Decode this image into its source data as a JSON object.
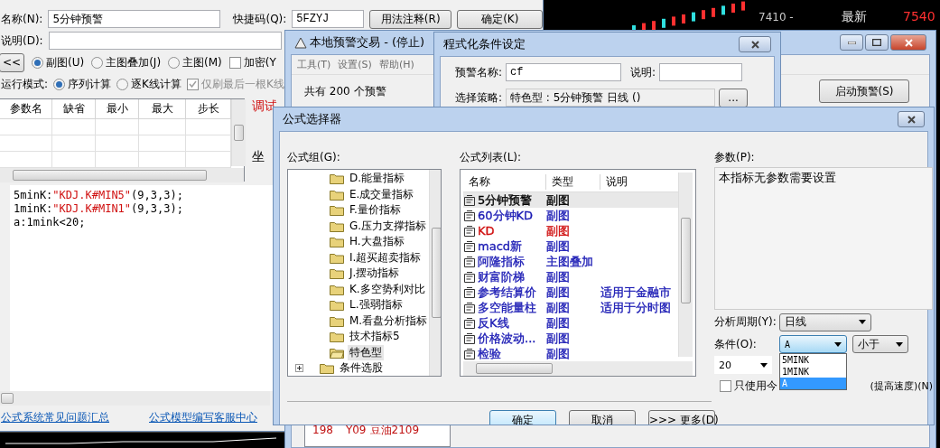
{
  "editor": {
    "name_label": "名称(N):",
    "name_value": "5分钟预警",
    "shortcut_label": "快捷码(Q):",
    "shortcut_value": "5FZYJ",
    "usage_button": "用法注释(R)",
    "ok_button": "确定(K)",
    "desc_label": "说明(D):",
    "collapse_button": "<<",
    "chart_types": [
      {
        "label": "副图(U)",
        "selected": true
      },
      {
        "label": "主图叠加(J)",
        "selected": false
      },
      {
        "label": "主图(M)",
        "selected": false
      }
    ],
    "encrypt": {
      "label": "加密(Y",
      "checked": false
    },
    "run_mode_label": "运行模式:",
    "run_modes": [
      {
        "label": "序列计算",
        "selected": true
      },
      {
        "label": "逐K线计算",
        "selected": false
      }
    ],
    "refresh_last": {
      "label": "仅刷最后一根K线",
      "checked": true,
      "disabled": true
    },
    "param_columns": [
      "参数名",
      "缺省",
      "最小",
      "最大",
      "步长"
    ],
    "debug_label": "调试",
    "coord_label": "坐",
    "code_lines": [
      [
        {
          "kind": "plain",
          "text": "5minK:"
        },
        {
          "kind": "string",
          "text": "\"KDJ.K#MIN5\""
        },
        {
          "kind": "plain",
          "text": "(9,3,3);"
        }
      ],
      [
        {
          "kind": "plain",
          "text": "1minK:"
        },
        {
          "kind": "string",
          "text": "\"KDJ.K#MIN1\""
        },
        {
          "kind": "plain",
          "text": "(9,3,3);"
        }
      ],
      [
        {
          "kind": "plain",
          "text": "a:1mink<20;"
        }
      ]
    ],
    "links": [
      "公式系统常见问题汇总",
      "公式模型编写客服中心"
    ]
  },
  "chart_strip": {
    "price_label": "7410 -",
    "latest_label": "最新",
    "latest_value": "7540"
  },
  "alert_window": {
    "title": "本地预警交易 - (停止)",
    "menu": [
      "工具(T)",
      "设置(S)",
      "帮助(H)"
    ],
    "count_text": "共有 200 个预警",
    "start_button": "启动预警(S)",
    "rows": [
      {
        "number": "198",
        "code": "Y09",
        "name": "豆油2109"
      }
    ]
  },
  "condition_window": {
    "title": "程式化条件设定",
    "alert_name_label": "预警名称:",
    "alert_name_value": "cf",
    "desc_label": "说明:",
    "strategy_label": "选择策略:",
    "strategy_value": "特色型 : 5分钟预警 日线 ()",
    "browse_button": "..."
  },
  "selector": {
    "title": "公式选择器",
    "group_label": "公式组(G):",
    "list_label": "公式列表(L):",
    "params_label": "参数(P):",
    "groups": [
      {
        "label": "D.能量指标",
        "selected": false
      },
      {
        "label": "E.成交量指标",
        "selected": false
      },
      {
        "label": "F.量价指标",
        "selected": false
      },
      {
        "label": "G.压力支撑指标",
        "selected": false
      },
      {
        "label": "H.大盘指标",
        "selected": false
      },
      {
        "label": "I.超买超卖指标",
        "selected": false
      },
      {
        "label": "J.摆动指标",
        "selected": false
      },
      {
        "label": "K.多空势利对比",
        "selected": false
      },
      {
        "label": "L.强弱指标",
        "selected": false
      },
      {
        "label": "M.看盘分析指标",
        "selected": false
      },
      {
        "label": "技术指标5",
        "selected": false
      },
      {
        "label": "特色型",
        "selected": true
      }
    ],
    "next_group": {
      "label": "条件选股",
      "expanded": false
    },
    "columns": [
      "名称",
      "类型",
      "说明"
    ],
    "formulas": [
      {
        "name": "5分钟预警",
        "type": "副图",
        "color": "#000000",
        "selected": true
      },
      {
        "name": "60分钟KD",
        "type": "副图",
        "color": "#1a1ab4",
        "selected": false
      },
      {
        "name": "KD",
        "type": "副图",
        "color": "#d01010",
        "selected": false
      },
      {
        "name": "macd新",
        "type": "副图",
        "color": "#1a1ab4",
        "selected": false
      },
      {
        "name": "阿隆指标",
        "type": "主图叠加",
        "color": "#1a1ab4",
        "selected": false
      },
      {
        "name": "财富阶梯",
        "type": "副图",
        "color": "#1a1ab4",
        "selected": false
      },
      {
        "name": "参考结算价",
        "type": "副图",
        "note": "适用于金融市",
        "color": "#1a1ab4",
        "selected": false
      },
      {
        "name": "多空能量柱",
        "type": "副图",
        "note": "适用于分时图",
        "color": "#1a1ab4",
        "selected": false
      },
      {
        "name": "反K线",
        "type": "副图",
        "color": "#1a1ab4",
        "selected": false
      },
      {
        "name": "价格波动...",
        "type": "副图",
        "color": "#1a1ab4",
        "selected": false
      },
      {
        "name": "检验",
        "type": "副图",
        "color": "#1a1ab4",
        "selected": false
      }
    ],
    "params_text": "本指标无参数需要设置",
    "period_label": "分析周期(Y):",
    "period_value": "日线",
    "condition_label": "条件(O):",
    "condition_value": "A",
    "operator_value": "小于",
    "threshold_value": "20",
    "condition_options": [
      {
        "label": "5MINK",
        "selected": false
      },
      {
        "label": "1MINK",
        "selected": false
      },
      {
        "label": "A",
        "selected": true
      }
    ],
    "today_only": {
      "label": "只使用今",
      "label_tail": "(提高速度)(N)",
      "checked": false
    },
    "buttons": [
      {
        "label": "确定",
        "kind": "default"
      },
      {
        "label": "取消",
        "kind": "normal"
      },
      {
        "label": ">>> 更多(D)",
        "kind": "normal"
      }
    ]
  }
}
